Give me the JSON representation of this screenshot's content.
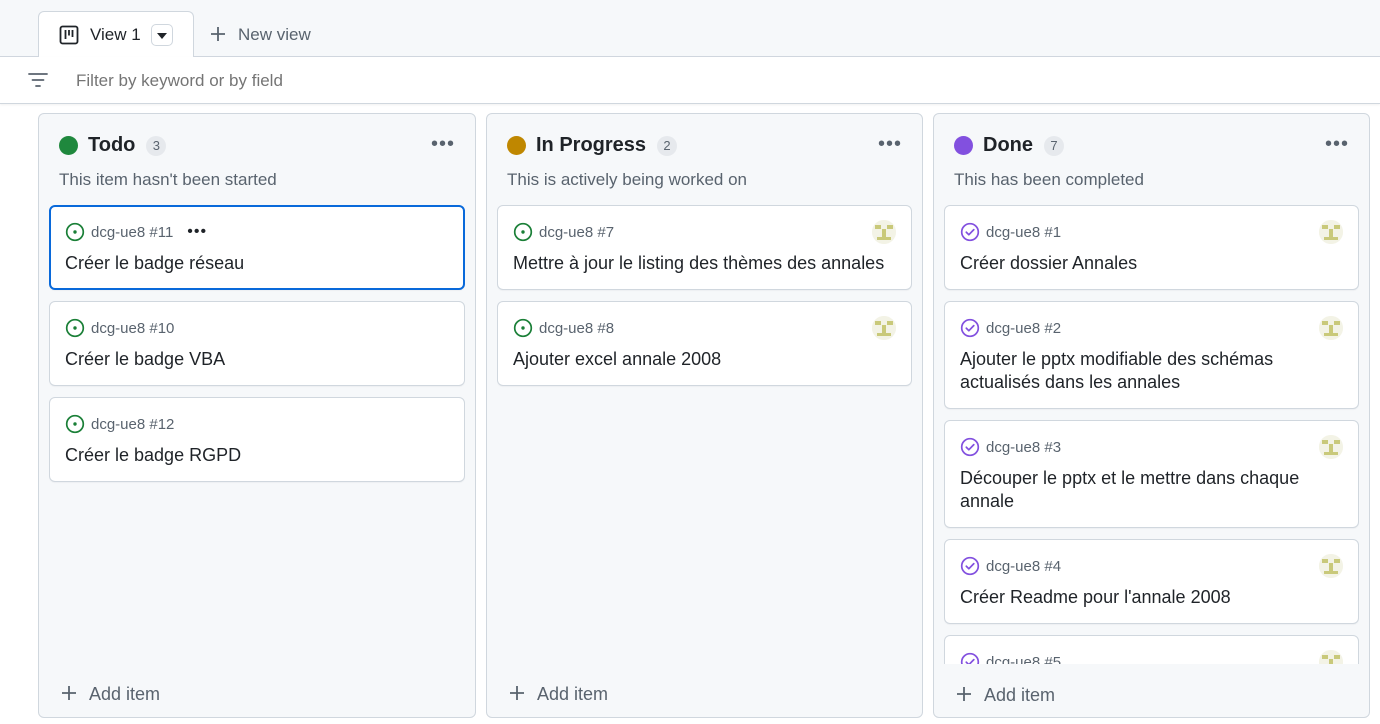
{
  "views": {
    "active_tab_label": "View 1",
    "new_view_label": "New view"
  },
  "filter": {
    "placeholder": "Filter by keyword or by field"
  },
  "columns": [
    {
      "title": "Todo",
      "count": "3",
      "description": "This item hasn't been started",
      "dot_color": "#1f883d",
      "add_item_label": "Add item",
      "cards": [
        {
          "ref": "dcg-ue8 #11",
          "title": "Créer le badge réseau",
          "status": "open"
        },
        {
          "ref": "dcg-ue8 #10",
          "title": "Créer le badge VBA",
          "status": "open"
        },
        {
          "ref": "dcg-ue8 #12",
          "title": "Créer le badge RGPD",
          "status": "open"
        }
      ]
    },
    {
      "title": "In Progress",
      "count": "2",
      "description": "This is actively being worked on",
      "dot_color": "#bf8700",
      "add_item_label": "Add item",
      "cards": [
        {
          "ref": "dcg-ue8 #7",
          "title": "Mettre à jour le listing des thèmes des annales",
          "status": "open"
        },
        {
          "ref": "dcg-ue8 #8",
          "title": "Ajouter excel annale 2008",
          "status": "open"
        }
      ]
    },
    {
      "title": "Done",
      "count": "7",
      "description": "This has been completed",
      "dot_color": "#8250df",
      "add_item_label": "Add item",
      "cards": [
        {
          "ref": "dcg-ue8 #1",
          "title": "Créer dossier Annales",
          "status": "closed"
        },
        {
          "ref": "dcg-ue8 #2",
          "title": "Ajouter le pptx modifiable des schémas actualisés dans les annales",
          "status": "closed"
        },
        {
          "ref": "dcg-ue8 #3",
          "title": "Découper le pptx et le mettre dans chaque annale",
          "status": "closed"
        },
        {
          "ref": "dcg-ue8 #4",
          "title": "Créer Readme pour l'annale 2008",
          "status": "closed"
        },
        {
          "ref": "dcg-ue8 #5",
          "title": "",
          "status": "closed"
        }
      ]
    }
  ],
  "colors": {
    "open_issue": "#1a7f37",
    "closed_issue": "#8250df",
    "selected_border": "#0969da"
  },
  "icons": {
    "view_tab": "project-board-icon",
    "dropdown": "triangle-down-icon",
    "new_view": "plus-icon",
    "filter": "filter-icon",
    "column_menu": "kebab-horizontal-icon",
    "open_issue": "issue-opened-icon",
    "closed_issue": "issue-closed-icon",
    "add_item": "plus-icon"
  }
}
